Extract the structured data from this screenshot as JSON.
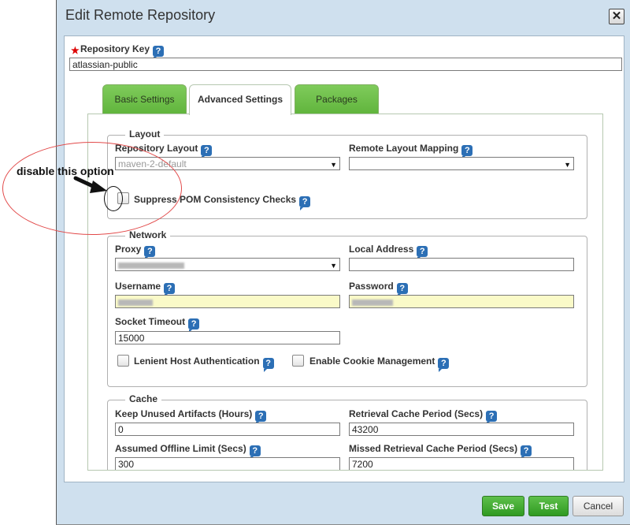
{
  "dialog": {
    "title": "Edit Remote Repository",
    "close_icon": "✕"
  },
  "repository_key": {
    "label": "Repository Key",
    "value": "atlassian-public"
  },
  "tabs": [
    {
      "label": "Basic Settings"
    },
    {
      "label": "Advanced Settings"
    },
    {
      "label": "Packages"
    }
  ],
  "layout": {
    "legend": "Layout",
    "repository_layout_label": "Repository Layout",
    "repository_layout_value": "maven-2-default",
    "remote_layout_mapping_label": "Remote Layout Mapping",
    "remote_layout_mapping_value": "",
    "suppress_pom_label": "Suppress POM Consistency Checks"
  },
  "network": {
    "legend": "Network",
    "proxy_label": "Proxy",
    "local_address_label": "Local Address",
    "local_address_value": "",
    "username_label": "Username",
    "password_label": "Password",
    "socket_timeout_label": "Socket Timeout",
    "socket_timeout_value": "15000",
    "lenient_host_auth_label": "Lenient Host Authentication",
    "enable_cookie_label": "Enable Cookie Management"
  },
  "cache": {
    "legend": "Cache",
    "keep_unused_label": "Keep Unused Artifacts (Hours)",
    "keep_unused_value": "0",
    "retrieval_cache_label": "Retrieval Cache Period (Secs)",
    "retrieval_cache_value": "43200",
    "assumed_offline_label": "Assumed Offline Limit (Secs)",
    "assumed_offline_value": "300",
    "missed_retrieval_label": "Missed Retrieval Cache Period (Secs)",
    "missed_retrieval_value": "7200"
  },
  "help_icon": "?",
  "buttons": {
    "save": "Save",
    "test": "Test",
    "cancel": "Cancel"
  },
  "annotation": {
    "text": "disable this option"
  },
  "colors": {
    "accent_green": "#5ec04a",
    "required_red": "#dd0000",
    "help_blue": "#2c6fb5",
    "annotation_red": "#e24a4a"
  }
}
